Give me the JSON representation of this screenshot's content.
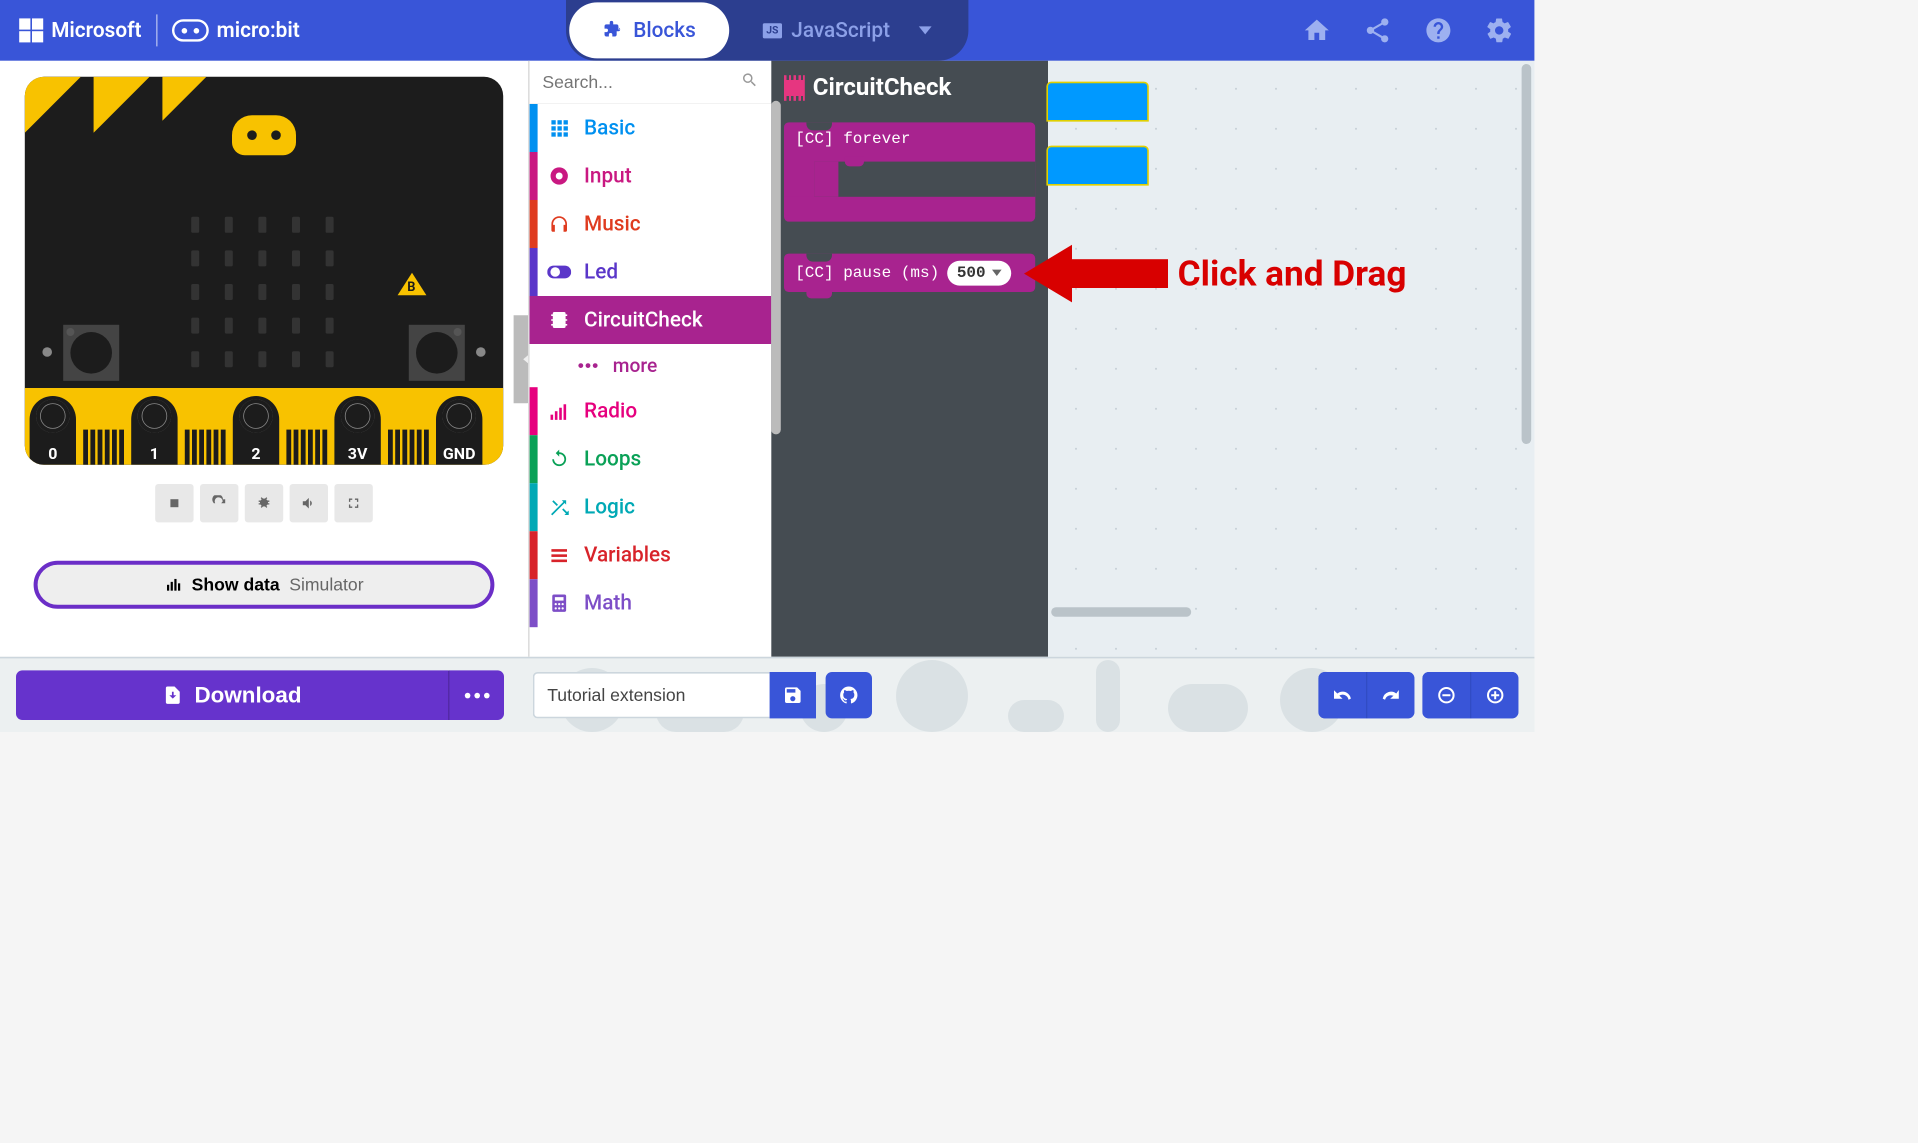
{
  "header": {
    "brand1": "Microsoft",
    "brand2": "micro:bit",
    "tab_blocks": "Blocks",
    "tab_js": "JavaScript"
  },
  "search": {
    "placeholder": "Search..."
  },
  "categories": [
    {
      "label": "Basic",
      "color": "#0090f0",
      "text": "#0090f0",
      "icon": "grid"
    },
    {
      "label": "Input",
      "color": "#c91881",
      "text": "#c91881",
      "icon": "circle-dot"
    },
    {
      "label": "Music",
      "color": "#df3b1f",
      "text": "#df3b1f",
      "icon": "headphones"
    },
    {
      "label": "Led",
      "color": "#5a36c9",
      "text": "#5a36c9",
      "icon": "toggle"
    },
    {
      "label": "CircuitCheck",
      "color": "#a8238f",
      "text": "#ffffff",
      "icon": "chip",
      "active": true
    },
    {
      "label": "more",
      "color": "#a8238f",
      "text": "#a8238f",
      "icon": "dots",
      "sub": true
    },
    {
      "label": "Radio",
      "color": "#e6007e",
      "text": "#e6007e",
      "icon": "bars"
    },
    {
      "label": "Loops",
      "color": "#0aa157",
      "text": "#0aa157",
      "icon": "loop"
    },
    {
      "label": "Logic",
      "color": "#00a9b5",
      "text": "#00a9b5",
      "icon": "shuffle"
    },
    {
      "label": "Variables",
      "color": "#d8232a",
      "text": "#d8232a",
      "icon": "lines"
    },
    {
      "label": "Math",
      "color": "#7d4ec7",
      "text": "#7d4ec7",
      "icon": "calc"
    }
  ],
  "flyout": {
    "title": "CircuitCheck",
    "block_forever": "[CC] forever",
    "block_pause": "[CC] pause (ms)",
    "pause_value": "500"
  },
  "pins": [
    "0",
    "1",
    "2",
    "3V",
    "GND"
  ],
  "sim": {
    "show_data_bold": "Show data",
    "show_data_light": "Simulator"
  },
  "annotation": "Click and Drag",
  "footer": {
    "download": "Download",
    "project_name": "Tutorial extension"
  }
}
